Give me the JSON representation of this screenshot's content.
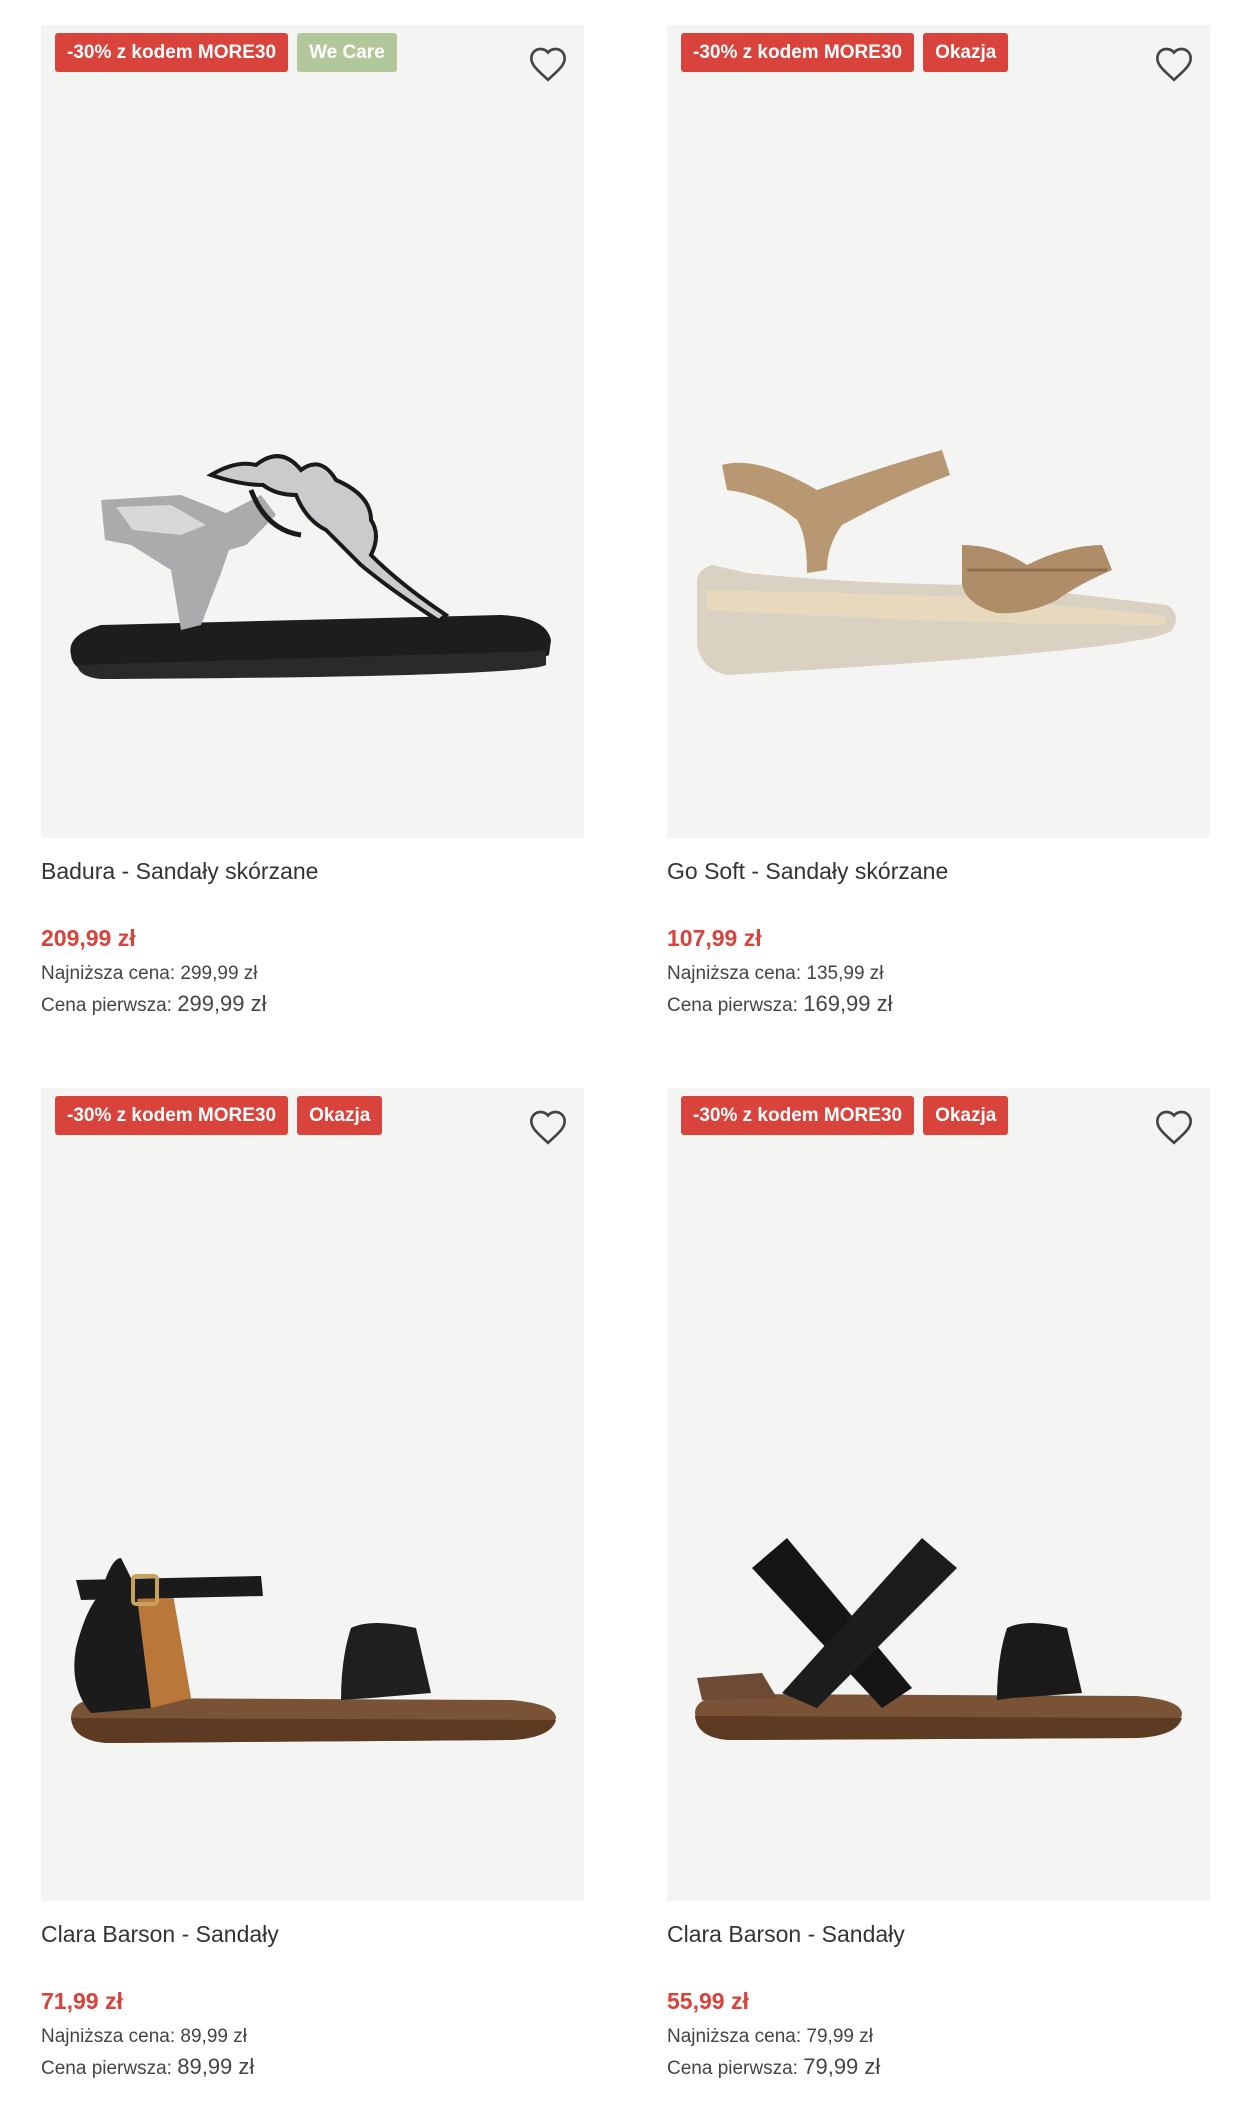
{
  "products": [
    {
      "badges": [
        "-30% z kodem MORE30",
        "We Care"
      ],
      "name": "Badura - Sandały skórzane",
      "price": "209,99 zł",
      "lowest_label": "Najniższa cena:",
      "lowest_value": "299,99 zł",
      "first_label": "Cena pierwsza:",
      "first_value": "299,99 zł"
    },
    {
      "badges": [
        "-30% z kodem MORE30",
        "Okazja"
      ],
      "name": "Go Soft - Sandały skórzane",
      "price": "107,99 zł",
      "lowest_label": "Najniższa cena:",
      "lowest_value": "135,99 zł",
      "first_label": "Cena pierwsza:",
      "first_value": "169,99 zł"
    },
    {
      "badges": [
        "-30% z kodem MORE30",
        "Okazja"
      ],
      "name": "Clara Barson - Sandały",
      "price": "71,99 zł",
      "lowest_label": "Najniższa cena:",
      "lowest_value": "89,99 zł",
      "first_label": "Cena pierwsza:",
      "first_value": "89,99 zł"
    },
    {
      "badges": [
        "-30% z kodem MORE30",
        "Okazja"
      ],
      "name": "Clara Barson - Sandały",
      "price": "55,99 zł",
      "lowest_label": "Najniższa cena:",
      "lowest_value": "79,99 zł",
      "first_label": "Cena pierwsza:",
      "first_value": "79,99 zł"
    }
  ],
  "colors": {
    "promo": "#d8433b",
    "we_care": "#b3c89a",
    "image_bg": "#f4f4f3"
  }
}
